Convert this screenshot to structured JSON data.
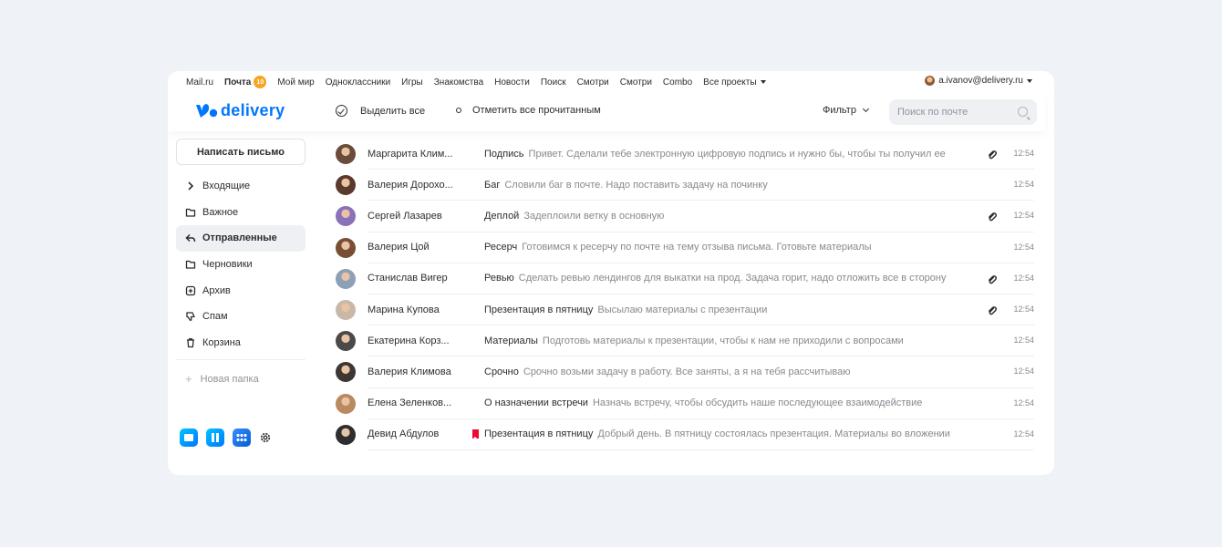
{
  "topbar": {
    "links": [
      "Mail.ru",
      "Почта",
      "Мой мир",
      "Одноклассники",
      "Игры",
      "Знакомства",
      "Новости",
      "Поиск",
      "Смотри",
      "Смотри",
      "Combo",
      "Все проекты"
    ],
    "mail_badge": "10",
    "user_email": "a.ivanov@delivery.ru"
  },
  "header": {
    "logo_text": "delivery",
    "select_all": "Выделить все",
    "mark_read": "Отметить все прочитанным",
    "filter": "Фильтр",
    "search_placeholder": "Поиск по почте"
  },
  "sidebar": {
    "compose": "Написать письмо",
    "folders": [
      {
        "label": "Входящие",
        "icon": "chevron-right-icon"
      },
      {
        "label": "Важное",
        "icon": "folder-icon"
      },
      {
        "label": "Отправленные",
        "icon": "reply-icon"
      },
      {
        "label": "Черновики",
        "icon": "folder-icon"
      },
      {
        "label": "Архив",
        "icon": "archive-icon"
      },
      {
        "label": "Спам",
        "icon": "thumbs-down-icon"
      },
      {
        "label": "Корзина",
        "icon": "trash-icon"
      }
    ],
    "active_folder_index": 2,
    "new_folder": "Новая папка"
  },
  "mails": [
    {
      "sender": "Маргарита Клим...",
      "subject": "Подпись",
      "snippet": "Привет. Сделали тебе электронную цифровую подпись и нужно бы, чтобы ты получил ее",
      "time": "12:54",
      "attachment": true,
      "flagged": false,
      "avatar_color": "#6b4b3a"
    },
    {
      "sender": "Валерия Дорохо...",
      "subject": "Баг",
      "snippet": "Словили баг в почте. Надо поставить задачу на починку",
      "time": "12:54",
      "attachment": false,
      "flagged": false,
      "avatar_color": "#5a3a2c"
    },
    {
      "sender": "Сергей Лазарев",
      "subject": "Деплой",
      "snippet": "Задеплоили ветку в основную",
      "time": "12:54",
      "attachment": true,
      "flagged": false,
      "avatar_color": "#8a72b8"
    },
    {
      "sender": "Валерия Цой",
      "subject": "Ресерч",
      "snippet": "Готовимся к ресерчу по почте на тему отзыва письма. Готовьте материалы",
      "time": "12:54",
      "attachment": false,
      "flagged": false,
      "avatar_color": "#7a4e34"
    },
    {
      "sender": "Станислав Вигер",
      "subject": "Ревью",
      "snippet": "Сделать ревью лендингов для выкатки на прод. Задача горит, надо отложить все в сторону",
      "time": "12:54",
      "attachment": true,
      "flagged": false,
      "avatar_color": "#8da0b5"
    },
    {
      "sender": "Марина Купова",
      "subject": "Презентация в пятницу",
      "snippet": "Высылаю материалы с презентации",
      "time": "12:54",
      "attachment": true,
      "flagged": false,
      "avatar_color": "#c9b8a8"
    },
    {
      "sender": "Екатерина Корз...",
      "subject": "Материалы",
      "snippet": "Подготовь материалы к презентации, чтобы к нам не приходили с вопросами",
      "time": "12:54",
      "attachment": false,
      "flagged": false,
      "avatar_color": "#4a4a4a"
    },
    {
      "sender": "Валерия Климова",
      "subject": "Срочно",
      "snippet": "Срочно возьми задачу в работу. Все заняты, а я на тебя рассчитываю",
      "time": "12:54",
      "attachment": false,
      "flagged": false,
      "avatar_color": "#3e3633"
    },
    {
      "sender": "Елена Зеленков...",
      "subject": "О назначении встречи",
      "snippet": "Назначь встречу, чтобы обсудить наше последующее взаимодействие",
      "time": "12:54",
      "attachment": false,
      "flagged": false,
      "avatar_color": "#b88a5e"
    },
    {
      "sender": "Девид Абдулов",
      "subject": "Презентация в пятницу",
      "snippet": "Добрый день. В пятницу состоялась презентация. Материалы во вложении",
      "time": "12:54",
      "attachment": false,
      "flagged": true,
      "avatar_color": "#2e2e2e"
    }
  ],
  "colors": {
    "accent": "#0077ff",
    "flag": "#ed0a34",
    "badge": "#f5a623"
  }
}
